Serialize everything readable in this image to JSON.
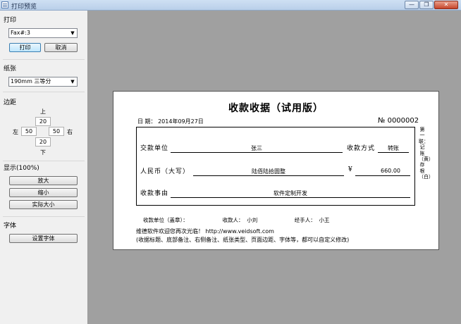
{
  "window": {
    "title": "打印预览",
    "min_glyph": "—",
    "restore_glyph": "❐",
    "close_glyph": "✕"
  },
  "print_group": {
    "label": "打印",
    "printer": "Fax#:3",
    "print_button": "打印",
    "cancel_button": "取消"
  },
  "paper_group": {
    "label": "纸张",
    "size": "190mm 三等分"
  },
  "margin_group": {
    "label": "边距",
    "top_label": "上",
    "top": "20",
    "left_label": "左",
    "left": "50",
    "right": "50",
    "right_label": "右",
    "bottom": "20",
    "bottom_label": "下"
  },
  "display_group": {
    "label": "显示(100%)",
    "zoom_in": "放大",
    "zoom_out": "缩小",
    "actual_size": "实际大小"
  },
  "font_group": {
    "label": "字体",
    "set_font": "设置字体"
  },
  "receipt": {
    "title": "收款收据（试用版）",
    "date": "日 期： 2014年09月27日",
    "number": "№ 0000002",
    "payer_label": "交款单位",
    "payer": "张三",
    "method_label": "收款方式",
    "method": "转账",
    "amount_words_label": "人民币（大写）",
    "amount_words": "陆佰陆拾圆整",
    "currency": "¥",
    "amount": "660.00",
    "reason_label": "收款事由",
    "reason": "软件定制开发",
    "side_note": "第一联：记账（黄）存根（白）",
    "signature_line": "收款单位（盖章）：　　　　　　　收款人：  小刘　　　　　　　经手人：  小王",
    "footer_1": "维德软件欢迎您再次光临！  http://www.veidsoft.com",
    "footer_2": "(收据标题、底部备注、右侧备注、纸张类型、页面边距、字体等，都可以自定义修改)"
  }
}
